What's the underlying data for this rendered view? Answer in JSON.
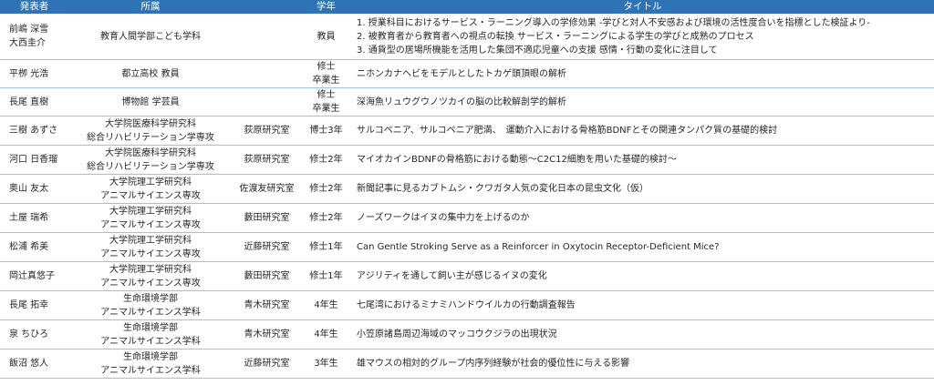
{
  "headers": {
    "presenter": "発表者",
    "affiliation": "所属",
    "lab": "",
    "year": "学年",
    "title": "タイトル"
  },
  "rows": [
    {
      "name": [
        "前嶋 深雪",
        "大西圭介"
      ],
      "affiliation": [
        "教育人間学部こども学科"
      ],
      "lab": "",
      "year": [
        "教員"
      ],
      "title": [
        "1. 授業科目におけるサービス・ラーニング導入の学修効果 -学びと対人不安感および環境の活性度合いを指標とした検証より-",
        "2. 被教育者から教育者への視点の転換 サービス・ラーニングによる学生の学びと成熟のプロセス",
        "3. 通貨型の居場所機能を活用した集団不適応児童への支援 感情・行動の変化に注目して"
      ]
    },
    {
      "name": [
        "平栁 光浩"
      ],
      "affiliation": [
        "都立高校 教員"
      ],
      "lab": "",
      "year": [
        "修士",
        "卒業生"
      ],
      "title": [
        "ニホンカナヘビをモデルとしたトカゲ頭頂眼の解析"
      ]
    },
    {
      "name": [
        "長尾 直樹"
      ],
      "affiliation": [
        "博物館 学芸員"
      ],
      "lab": "",
      "year": [
        "修士",
        "卒業生"
      ],
      "title": [
        "深海魚リュウグウノツカイの脳の比較解剖学的解析"
      ]
    },
    {
      "name": [
        "三樹 あずさ"
      ],
      "affiliation": [
        "大学院医療科学研究科",
        "総合リハビリテーション学専攻"
      ],
      "lab": "荻原研究室",
      "year": [
        "博士3年"
      ],
      "title": [
        "サルコペニア、サルコペニア肥満、　運動介入における骨格筋BDNFとその関連タンパク質の基礎的検討"
      ]
    },
    {
      "name": [
        "河口 日香瑠"
      ],
      "affiliation": [
        "大学院医療科学研究科",
        "総合リハビリテーション学専攻"
      ],
      "lab": "荻原研究室",
      "year": [
        "修士2年"
      ],
      "title": [
        "マイオカインBDNFの骨格筋における動態〜C2C12細胞を用いた基礎的検討〜"
      ]
    },
    {
      "name": [
        "奥山 友太"
      ],
      "affiliation": [
        "大学院理工学研究科",
        "アニマルサイエンス専攻"
      ],
      "lab": "佐渡友研究室",
      "year": [
        "修士2年"
      ],
      "title": [
        "新聞記事に見るカブトムシ・クワガタ人気の変化日本の昆虫文化（仮）"
      ]
    },
    {
      "name": [
        "土屋 瑞希"
      ],
      "affiliation": [
        "大学院理工学研究科",
        "アニマルサイエンス専攻"
      ],
      "lab": "藪田研究室",
      "year": [
        "修士2年"
      ],
      "title": [
        "ノーズワークはイヌの集中力を上げるのか"
      ]
    },
    {
      "name": [
        "松浦 希美"
      ],
      "affiliation": [
        "大学院理工学研究科",
        "アニマルサイエンス専攻"
      ],
      "lab": "近藤研究室",
      "year": [
        "修士1年"
      ],
      "title": [
        "Can Gentle Stroking Serve as a Reinforcer in Oxytocin Receptor-Deficient Mice?"
      ]
    },
    {
      "name": [
        "岡辻真悠子"
      ],
      "affiliation": [
        "大学院理工学研究科",
        "アニマルサイエンス専攻"
      ],
      "lab": "藪田研究室",
      "year": [
        "修士1年"
      ],
      "title": [
        "アジリティを通して飼い主が感じるイヌの変化"
      ]
    },
    {
      "name": [
        "長尾 拓幸"
      ],
      "affiliation": [
        "生命環境学部",
        "アニマルサイエンス学科"
      ],
      "lab": "青木研究室",
      "year": [
        "4年生"
      ],
      "title": [
        "七尾湾におけるミナミハンドウイルカの行動調査報告"
      ]
    },
    {
      "name": [
        "泉 ちひろ"
      ],
      "affiliation": [
        "生命環境学部",
        "アニマルサイエンス学科"
      ],
      "lab": "青木研究室",
      "year": [
        "4年生"
      ],
      "title": [
        "小笠原諸島周辺海域のマッコウクジラの出現状況"
      ]
    },
    {
      "name": [
        "飯沼 悠人"
      ],
      "affiliation": [
        "生命環境学部",
        "アニマルサイエンス学科"
      ],
      "lab": "近藤研究室",
      "year": [
        "3年生"
      ],
      "title": [
        "雄マウスの相対的グループ内序列経験が社会的優位性に与える影響"
      ]
    }
  ]
}
